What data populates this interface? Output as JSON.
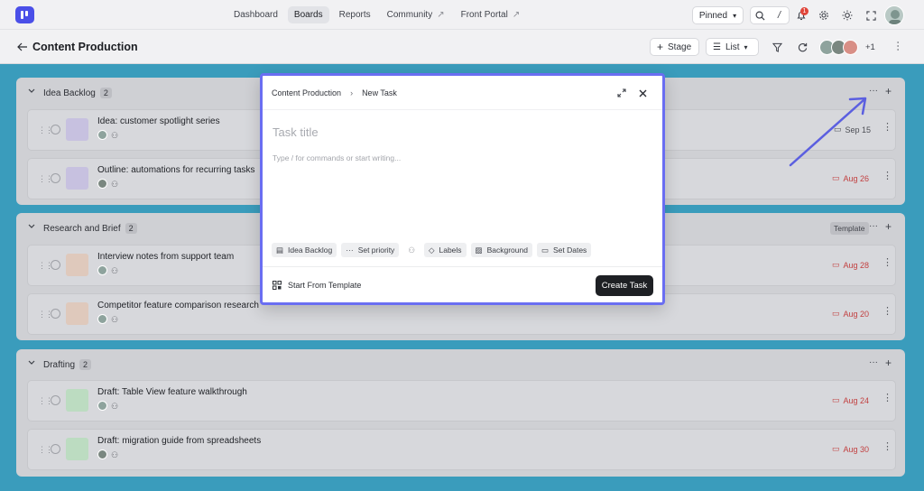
{
  "nav": {
    "items": [
      {
        "label": "Dashboard"
      },
      {
        "label": "Boards",
        "active": true
      },
      {
        "label": "Reports"
      },
      {
        "label": "Community",
        "external": true
      },
      {
        "label": "Front Portal",
        "external": true
      }
    ],
    "pinned_label": "Pinned",
    "notification_count": "1"
  },
  "page": {
    "title": "Content Production",
    "stage_label": "Stage",
    "view_label": "List",
    "extra_members": "+1"
  },
  "sections": [
    {
      "title": "Idea Backlog",
      "count": "2",
      "tasks": [
        {
          "name": "Idea: customer spotlight series",
          "date": "Sep 15",
          "overdue": false,
          "color": "#c7c1e0"
        },
        {
          "name": "Outline: automations for recurring tasks",
          "date": "Aug 26",
          "overdue": true,
          "color": "#c7c1e0"
        }
      ]
    },
    {
      "title": "Research and Brief",
      "count": "2",
      "template_label": "Template",
      "tasks": [
        {
          "name": "Interview notes from support team",
          "date": "Aug 28",
          "overdue": true,
          "color": "#dfc9bc"
        },
        {
          "name": "Competitor feature comparison research",
          "date": "Aug 20",
          "overdue": true,
          "color": "#dfc9bc"
        }
      ]
    },
    {
      "title": "Drafting",
      "count": "2",
      "tasks": [
        {
          "name": "Draft: Table View feature walkthrough",
          "date": "Aug 24",
          "overdue": true,
          "color": "#bcdcc1"
        },
        {
          "name": "Draft: migration guide from spreadsheets",
          "date": "Aug 30",
          "overdue": true,
          "color": "#bcdcc1"
        }
      ]
    }
  ],
  "modal": {
    "breadcrumb_board": "Content Production",
    "breadcrumb_current": "New Task",
    "title_placeholder": "Task title",
    "body_placeholder": "Type / for commands or start writing...",
    "chips": [
      "Idea Backlog",
      "Set priority",
      "Labels",
      "Background",
      "Set Dates"
    ],
    "template_label": "Start From Template",
    "create_label": "Create Task"
  },
  "colors": {
    "accent": "#4a4fe8",
    "overlay": "#3a9cbc",
    "modal_border": "#6a6ef2",
    "annotation_arrow": "#5b5fe0"
  }
}
